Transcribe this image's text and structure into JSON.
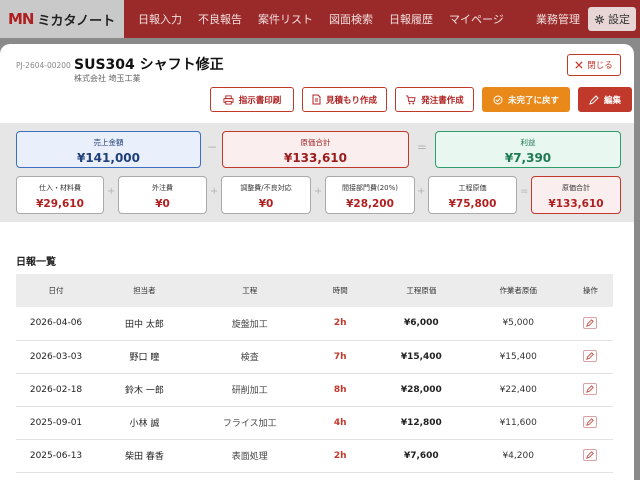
{
  "brand": {
    "mark": "MN",
    "name": "ミカタノート"
  },
  "nav": {
    "items": [
      "日報入力",
      "不良報告",
      "案件リスト",
      "図面検索",
      "日報履歴",
      "マイページ"
    ],
    "business": "業務管理",
    "settings": "設定"
  },
  "project": {
    "code": "PJ-2604-00200",
    "title": "SUS304 シャフト修正",
    "company": "株式会社 埼玉工業"
  },
  "buttons": {
    "close": "閉じる",
    "print": "指示書印刷",
    "estimate": "見積もり作成",
    "order": "発注書作成",
    "revert": "未完了に戻す",
    "edit": "編集"
  },
  "summary": {
    "sales": {
      "label": "売上金額",
      "value": "¥141,000"
    },
    "cost": {
      "label": "原価合計",
      "value": "¥133,610"
    },
    "profit": {
      "label": "利益",
      "value": "¥7,390"
    },
    "breakdown": [
      {
        "label": "仕入・材料費",
        "value": "¥29,610"
      },
      {
        "label": "外注費",
        "value": "¥0"
      },
      {
        "label": "調整費/不良対応",
        "value": "¥0"
      },
      {
        "label": "間接部門費(20%)",
        "value": "¥28,200"
      },
      {
        "label": "工程原価",
        "value": "¥75,800"
      },
      {
        "label": "原価合計",
        "value": "¥133,610"
      }
    ]
  },
  "daily": {
    "title": "日報一覧",
    "headers": [
      "日付",
      "担当者",
      "工程",
      "時間",
      "工程原価",
      "作業者原価",
      "操作"
    ],
    "rows": [
      [
        "2026-04-06",
        "田中 太郎",
        "旋盤加工",
        "2h",
        "¥6,000",
        "¥5,000"
      ],
      [
        "2026-03-03",
        "野口 瞳",
        "検査",
        "7h",
        "¥15,400",
        "¥15,400"
      ],
      [
        "2026-02-18",
        "鈴木 一郎",
        "研削加工",
        "8h",
        "¥28,000",
        "¥22,400"
      ],
      [
        "2025-09-01",
        "小林 誠",
        "フライス加工",
        "4h",
        "¥12,800",
        "¥11,600"
      ],
      [
        "2025-06-13",
        "柴田 春香",
        "表面処理",
        "2h",
        "¥7,600",
        "¥4,200"
      ]
    ]
  },
  "colors": {
    "accent": "#c0392b",
    "nav": "#9a2a2a",
    "orange": "#e8891a",
    "blue": "#3a6fc4",
    "green": "#2f9e6e"
  },
  "icons": [
    "settings-gear-icon",
    "close-x-icon",
    "printer-icon",
    "document-icon",
    "cart-icon",
    "revert-check-icon",
    "edit-icon",
    "pencil-icon"
  ]
}
